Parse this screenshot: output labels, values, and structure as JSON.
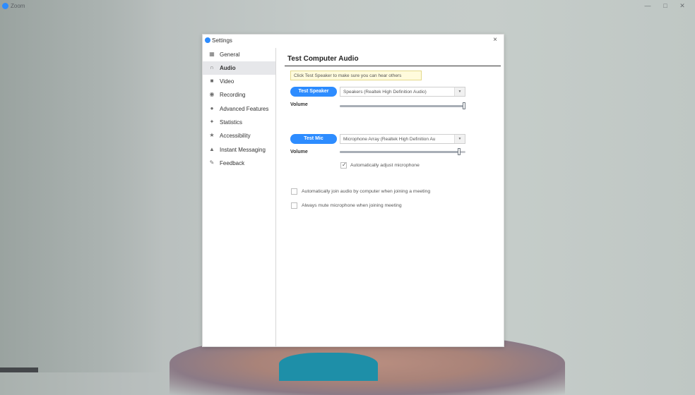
{
  "app": {
    "title": "Zoom"
  },
  "window_controls": {
    "minimize": "—",
    "restore": "□",
    "close": "✕"
  },
  "dialog": {
    "title": "Settings",
    "close": "×",
    "nav": [
      {
        "label": "General",
        "icon": "general-icon",
        "active": false
      },
      {
        "label": "Audio",
        "icon": "headphones-icon",
        "active": true
      },
      {
        "label": "Video",
        "icon": "video-camera-icon",
        "active": false
      },
      {
        "label": "Recording",
        "icon": "record-icon",
        "active": false
      },
      {
        "label": "Advanced Features",
        "icon": "user-icon",
        "active": false
      },
      {
        "label": "Statistics",
        "icon": "statistics-icon",
        "active": false
      },
      {
        "label": "Accessibility",
        "icon": "accessibility-icon",
        "active": false
      },
      {
        "label": "Instant Messaging",
        "icon": "chat-icon",
        "active": false
      },
      {
        "label": "Feedback",
        "icon": "feedback-icon",
        "active": false
      }
    ],
    "audio": {
      "section_title": "Test Computer Audio",
      "tooltip": "Click Test Speaker to make sure you can hear others",
      "speaker": {
        "button": "Test Speaker",
        "device": "Speakers (Realtek High Definition Audio)",
        "volume_label": "Volume",
        "volume": 1.0
      },
      "mic": {
        "button": "Test Mic",
        "device": "Microphone Array (Realtek High Definition Au",
        "volume_label": "Volume",
        "volume": 0.96
      },
      "auto_adjust": {
        "label": "Automatically adjust microphone",
        "checked": true
      },
      "auto_join": {
        "label": "Automatically join audio by computer when joining a meeting",
        "checked": false
      },
      "always_mute": {
        "label": "Always mute microphone when joining meeting",
        "checked": false
      }
    }
  }
}
